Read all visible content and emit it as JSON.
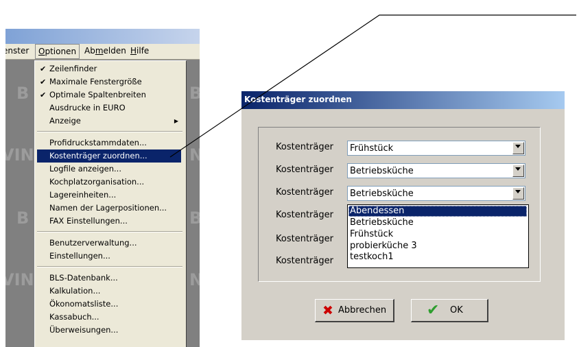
{
  "app": {
    "menubar": {
      "fenster": "enster",
      "optionen_pre": "",
      "optionen_u": "O",
      "optionen_post": "ptionen",
      "abmelden_pre": "Ab",
      "abmelden_u": "m",
      "abmelden_post": "elden",
      "hilfe_u": "H",
      "hilfe_post": "ilfe"
    },
    "background_watermark": [
      "B",
      "B",
      "VIN",
      "N",
      "B",
      "B",
      "VIN",
      "N"
    ],
    "options_menu": {
      "group1": [
        {
          "label": "Zeilenfinder",
          "checked": "✔"
        },
        {
          "label": "Maximale Fenstergröße",
          "checked": "✔"
        },
        {
          "label": "Optimale Spaltenbreiten",
          "checked": "✔"
        },
        {
          "label": "Ausdrucke in EURO",
          "checked": ""
        },
        {
          "label": "Anzeige",
          "submenu_arrow": "▶"
        }
      ],
      "group2": [
        {
          "label": "Profidruckstammdaten..."
        },
        {
          "label": "Kostenträger zuordnen...",
          "selected": true
        },
        {
          "label": "Logfile anzeigen..."
        },
        {
          "label": "Kochplatzorganisation..."
        },
        {
          "label": "Lagereinheiten..."
        },
        {
          "label": "Namen der Lagerpositionen..."
        },
        {
          "label": "FAX Einstellungen..."
        }
      ],
      "group3": [
        {
          "label": "Benutzerverwaltung..."
        },
        {
          "label": "Einstellungen..."
        }
      ],
      "group4": [
        {
          "label": "BLS-Datenbank..."
        },
        {
          "label": "Kalkulation..."
        },
        {
          "label": "Ökonomatsliste..."
        },
        {
          "label": "Kassabuch..."
        },
        {
          "label": "Überweisungen..."
        }
      ]
    }
  },
  "dialog": {
    "title": "Kostenträger zuordnen",
    "rows": [
      {
        "label": "Kostenträger",
        "value": "Frühstück"
      },
      {
        "label": "Kostenträger",
        "value": "Betriebsküche"
      },
      {
        "label": "Kostenträger",
        "value": "Betriebsküche"
      },
      {
        "label": "Kostenträger",
        "value": ""
      },
      {
        "label": "Kostenträger",
        "value": ""
      },
      {
        "label": "Kostenträger",
        "value": ""
      }
    ],
    "dropdown_options": [
      "Abendessen",
      "Betriebsküche",
      "Frühstück",
      "probierküche 3",
      "testkoch1"
    ],
    "highlighted_option": "Abendessen",
    "buttons": {
      "cancel_label": "Abbrechen",
      "cancel_icon": "✖",
      "ok_label": "OK",
      "ok_icon": "✔"
    }
  },
  "colors": {
    "menu_selection": "#0a246a",
    "cancel_icon": "#cc0000",
    "ok_icon": "#2e9e2e"
  }
}
